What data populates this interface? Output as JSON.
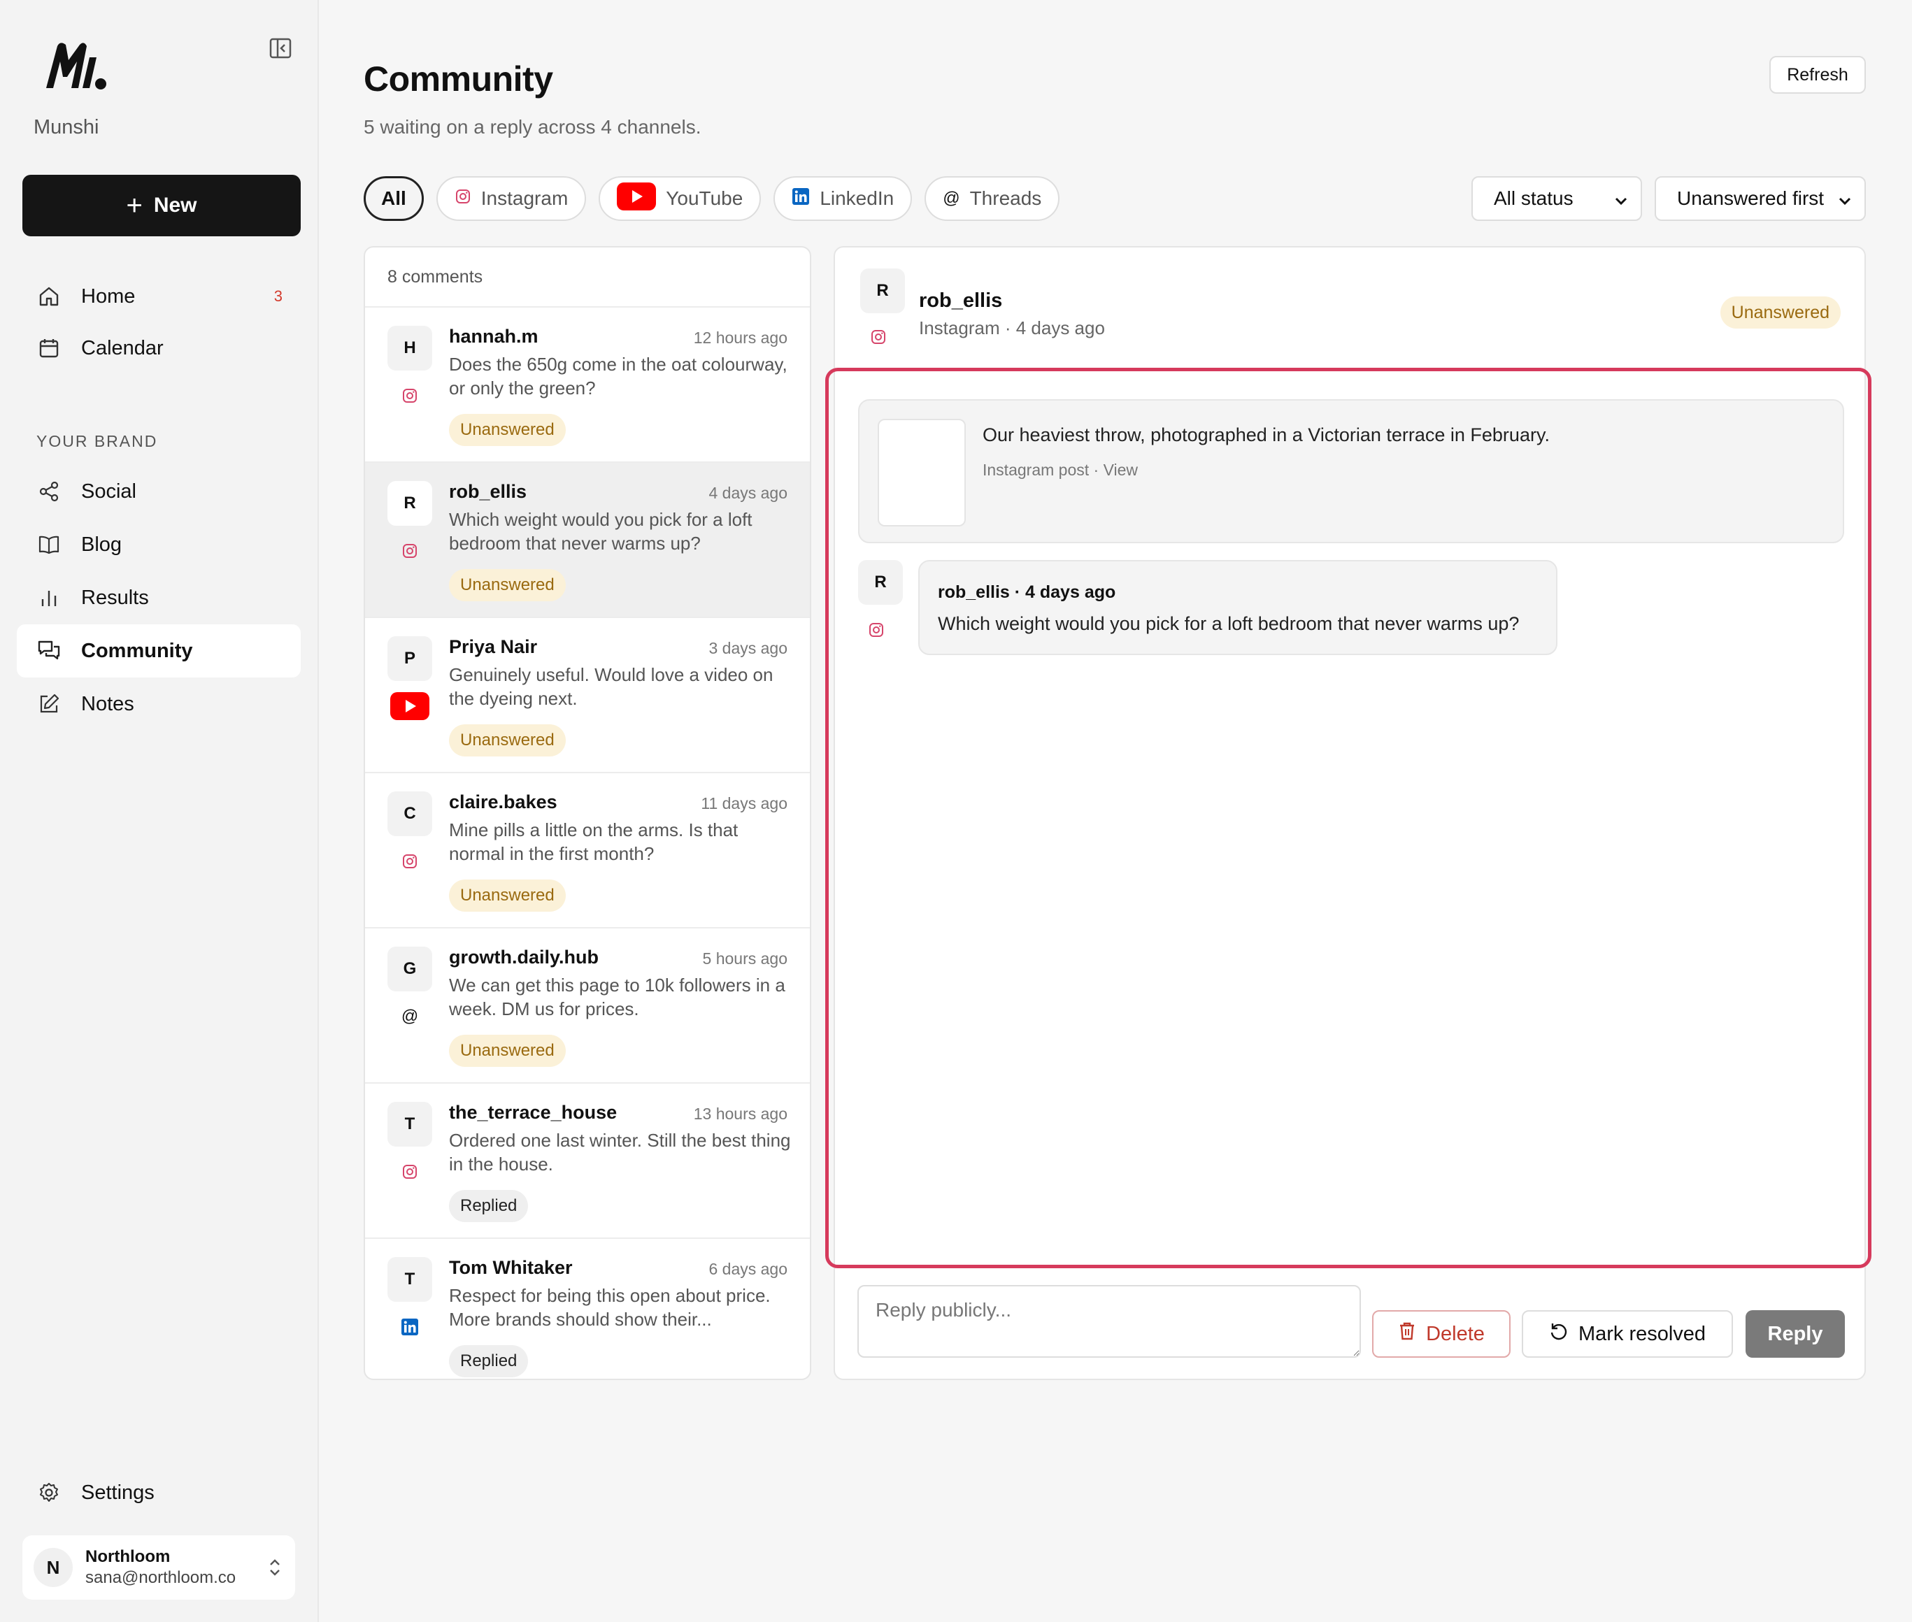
{
  "app": {
    "brand": "Munshi",
    "new_label": "New"
  },
  "sidebar": {
    "items": [
      {
        "label": "Home",
        "icon": "home-icon",
        "count": "3"
      },
      {
        "label": "Calendar",
        "icon": "calendar-icon"
      }
    ],
    "section_label": "YOUR BRAND",
    "brand_items": [
      {
        "label": "Social",
        "icon": "share-icon"
      },
      {
        "label": "Blog",
        "icon": "book-icon"
      },
      {
        "label": "Results",
        "icon": "bar-chart-icon"
      },
      {
        "label": "Community",
        "icon": "chat-icon",
        "active": true
      },
      {
        "label": "Notes",
        "icon": "edit-icon"
      }
    ],
    "settings_label": "Settings",
    "account": {
      "initial": "N",
      "name": "Northloom",
      "email": "sana@northloom.co"
    }
  },
  "header": {
    "title": "Community",
    "subtitle": "5 waiting on a reply across 4 channels.",
    "refresh_label": "Refresh"
  },
  "filters": {
    "channels": [
      {
        "label": "All",
        "active": true
      },
      {
        "label": "Instagram",
        "icon": "instagram-icon"
      },
      {
        "label": "YouTube",
        "icon": "youtube-icon"
      },
      {
        "label": "LinkedIn",
        "icon": "linkedin-icon"
      },
      {
        "label": "Threads",
        "icon": "threads-icon"
      }
    ],
    "status_select": "All status",
    "sort_select": "Unanswered first"
  },
  "comments": {
    "count_label": "8 comments",
    "items": [
      {
        "initial": "H",
        "platform": "instagram",
        "name": "hannah.m",
        "time": "12 hours ago",
        "text": "Does the 650g come in the oat colourway, or only the green?",
        "status": "Unanswered"
      },
      {
        "initial": "R",
        "platform": "instagram",
        "name": "rob_ellis",
        "time": "4 days ago",
        "text": "Which weight would you pick for a loft bedroom that never warms up?",
        "status": "Unanswered",
        "selected": true
      },
      {
        "initial": "P",
        "platform": "youtube",
        "name": "Priya Nair",
        "time": "3 days ago",
        "text": "Genuinely useful. Would love a video on the dyeing next.",
        "status": "Unanswered"
      },
      {
        "initial": "C",
        "platform": "instagram",
        "name": "claire.bakes",
        "time": "11 days ago",
        "text": "Mine pills a little on the arms. Is that normal in the first month?",
        "status": "Unanswered"
      },
      {
        "initial": "G",
        "platform": "threads",
        "name": "growth.daily.hub",
        "time": "5 hours ago",
        "text": "We can get this page to 10k followers in a week. DM us for prices.",
        "status": "Unanswered"
      },
      {
        "initial": "T",
        "platform": "instagram",
        "name": "the_terrace_house",
        "time": "13 hours ago",
        "text": "Ordered one last winter. Still the best thing in the house.",
        "status": "Replied"
      },
      {
        "initial": "T",
        "platform": "linkedin",
        "name": "Tom Whitaker",
        "time": "6 days ago",
        "text": "Respect for being this open about price. More brands should show their...",
        "status": "Replied"
      }
    ]
  },
  "detail": {
    "initial": "R",
    "name": "rob_ellis",
    "meta": "Instagram · 4 days ago",
    "status": "Unanswered",
    "post": {
      "text": "Our heaviest throw, photographed in a Victorian terrace in February.",
      "meta": "Instagram post · View"
    },
    "message": {
      "initial": "R",
      "head": "rob_ellis · 4 days ago",
      "text": "Which weight would you pick for a loft bedroom that never warms up?"
    },
    "reply_placeholder": "Reply publicly...",
    "delete_label": "Delete",
    "resolve_label": "Mark resolved",
    "reply_label": "Reply"
  },
  "colors": {
    "accent_dark": "#151515",
    "unanswered_bg": "#fbf1d8",
    "unanswered_text": "#9a6a10",
    "highlight": "#d63a5c",
    "instagram": "#d6456b",
    "youtube": "#ff0000",
    "linkedin": "#0a66c2"
  }
}
